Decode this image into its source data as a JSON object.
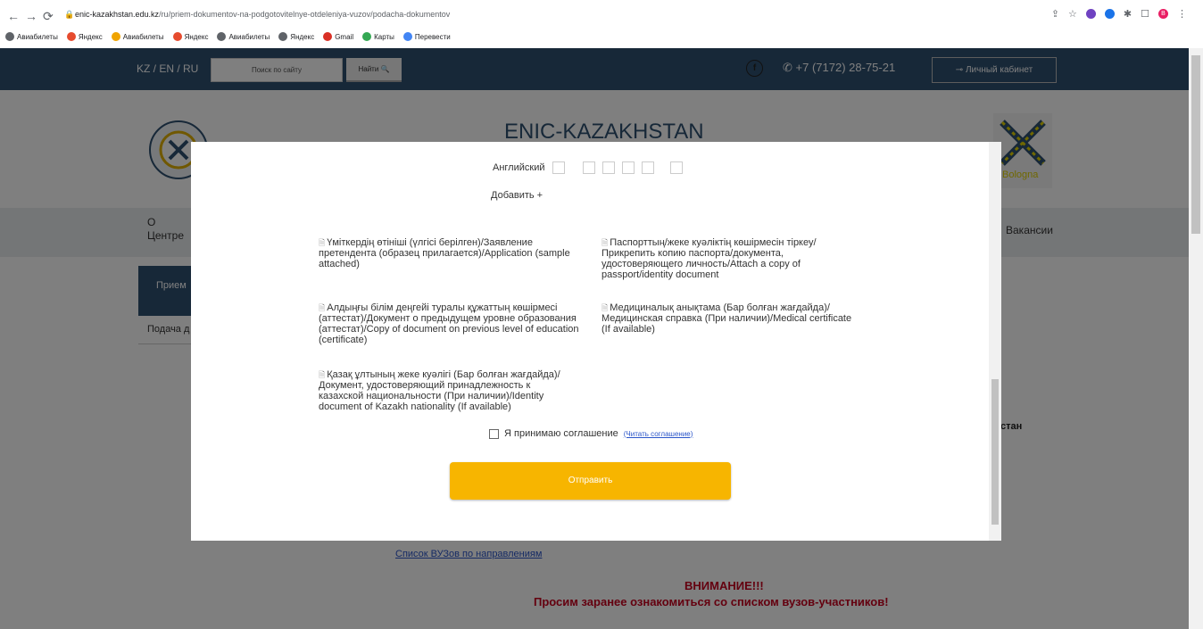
{
  "browser": {
    "url_host": "enic-kazakhstan.edu.kz",
    "url_path": "/ru/priem-dokumentov-na-podgotovitelnye-otdeleniya-vuzov/podacha-dokumentov",
    "nav_icons": [
      "back-icon",
      "forward-icon",
      "reload-icon",
      "lock-icon"
    ],
    "bookmarks": [
      {
        "label": "Авиабилеты",
        "icon": "globe-icon",
        "color": "#5f6368"
      },
      {
        "label": "Яндекс",
        "icon": "yandex-icon",
        "color": "#e64b2e"
      },
      {
        "label": "Авиабилеты",
        "icon": "plane-icon",
        "color": "#f0a400"
      },
      {
        "label": "Яндекс",
        "icon": "yandex-icon",
        "color": "#e64b2e"
      },
      {
        "label": "Авиабилеты",
        "icon": "globe-icon",
        "color": "#5f6368"
      },
      {
        "label": "Яндекс",
        "icon": "globe-icon",
        "color": "#5f6368"
      },
      {
        "label": "Gmail",
        "icon": "gmail-icon",
        "color": "#d93025"
      },
      {
        "label": "Карты",
        "icon": "maps-icon",
        "color": "#34a853"
      },
      {
        "label": "Перевести",
        "icon": "translate-icon",
        "color": "#4285f4"
      }
    ],
    "profile_initial": "B"
  },
  "site": {
    "langs": "KZ / EN / RU",
    "search_placeholder": "Поиск по сайту",
    "search_button": "Найти",
    "phone": "+7 (7172) 28-75-21",
    "cabinet": "Личный кабинет",
    "brand": "ENIC-KAZAKHSTAN",
    "bologna_text": "ologna\nrocess",
    "menu_left": "О\nЦентре",
    "menu_right": "Вакансии",
    "side_box": "Прием",
    "side_link": "Подача д",
    "right_frag": "стан",
    "list_link": "Список ВУЗов по направлениям",
    "attention": "ВНИМАНИЕ!!!",
    "attention2": "Просим заранее ознакомиться со списком вузов-участников!"
  },
  "modal": {
    "lang_label": "Английский",
    "add_more": "Добавить +",
    "documents": [
      {
        "text": "Үміткердің өтініші (үлгісі берілген)/Заявление претендента (образец прилагается)/Application (sample attached)"
      },
      {
        "text": "Паспорттың/жеке куәліктің көшірмесін тіркеу/ Прикрепить копию паспорта/документа, удостоверяющего личность/Attach a copy of passport/identity document"
      },
      {
        "text": "Алдыңғы білім деңгейі туралы құжаттың көшірмесі (аттестат)/Документ о предыдущем уровне образования (аттестат)/Copy of document on previous level of education (certificate)"
      },
      {
        "text": "Медициналық анықтама (Бар болған жағдайда)/ Медицинская справка (При наличии)/Medical certificate (If available)"
      },
      {
        "text": "Қазақ ұлтының жеке куәлігі (Бар болған жағдайда)/ Документ, удостоверяющий принадлежность к казахской национальности (При наличии)/Identity document of Kazakh nationality (If available)"
      }
    ],
    "agree_label": "Я принимаю соглашение",
    "agree_link": "(Читать соглашение)",
    "submit_label": "Отправить"
  },
  "colors": {
    "topbar": "#2f5071",
    "submit": "#f7b500",
    "attention": "#c8001e"
  }
}
